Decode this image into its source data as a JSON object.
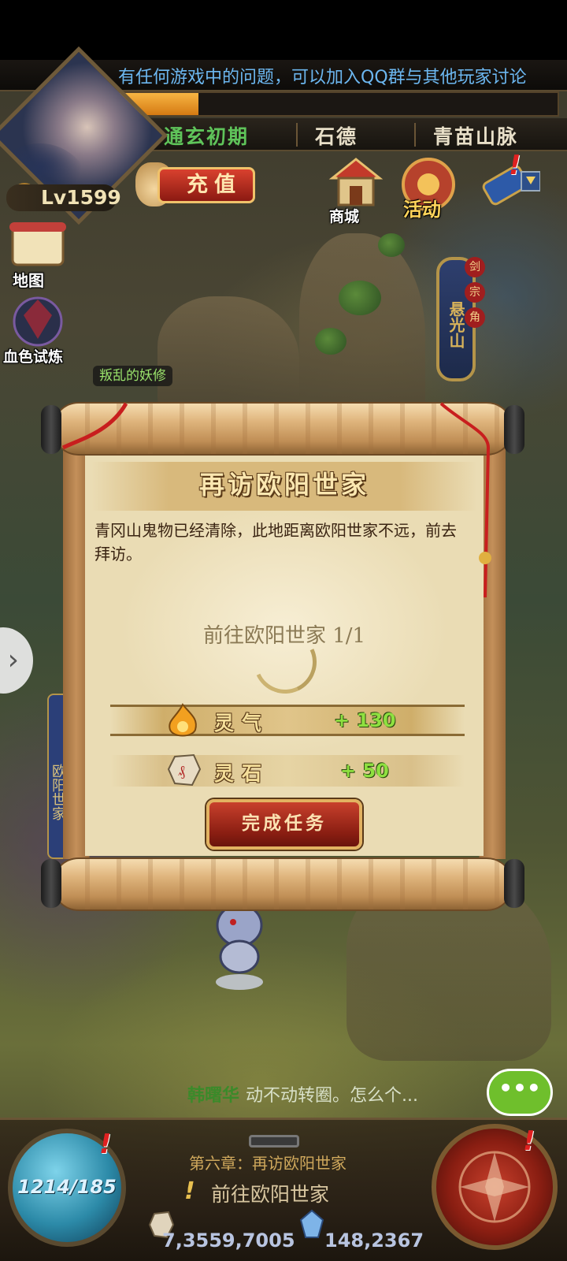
{
  "notice": {
    "text": "有任何游戏中的问题，可以加入QQ群与其他玩家讨论"
  },
  "exp": {
    "fill_fraction": 0.18
  },
  "status": {
    "realm": "通玄初期",
    "guild": "石德",
    "location": "青苗山脉"
  },
  "player": {
    "level": "Lv1599"
  },
  "recharge": {
    "label": "充值"
  },
  "top_icons": {
    "shop": "商城",
    "event": "活动"
  },
  "left_icons": {
    "map": "地图",
    "trial": "血色试炼"
  },
  "area_sign": {
    "name": "悬光山",
    "tags": [
      "剑",
      "宗",
      "角"
    ]
  },
  "npc": {
    "tag": "叛乱的妖修"
  },
  "side_sign": {
    "text": "欧阳世家"
  },
  "dialog": {
    "title": "再访欧阳世家",
    "description": "青冈山鬼物已经清除，此地距离欧阳世家不远，前去拜访。",
    "progress": "前往欧阳世家  1/1",
    "rewards": [
      {
        "name": "灵气",
        "value": "+ 130",
        "icon": "spirit-flame-icon"
      },
      {
        "name": "灵石",
        "value": "+ 50",
        "icon": "spirit-stone-icon"
      }
    ],
    "complete_button": "完成任务"
  },
  "chat": {
    "name": "韩曙华",
    "message": "动不动转圈。怎么个..."
  },
  "bottom": {
    "chapter": "第六章：再访欧阳世家",
    "quest": "前往欧阳世家",
    "hp": "1214/185",
    "gold": "7,3559,7005",
    "gems": "148,2367"
  },
  "colors": {
    "accent_red": "#8a1e12",
    "gold_text": "#f5df9a",
    "reward_green": "#8ee040",
    "notice_blue": "#6cb7f0"
  }
}
